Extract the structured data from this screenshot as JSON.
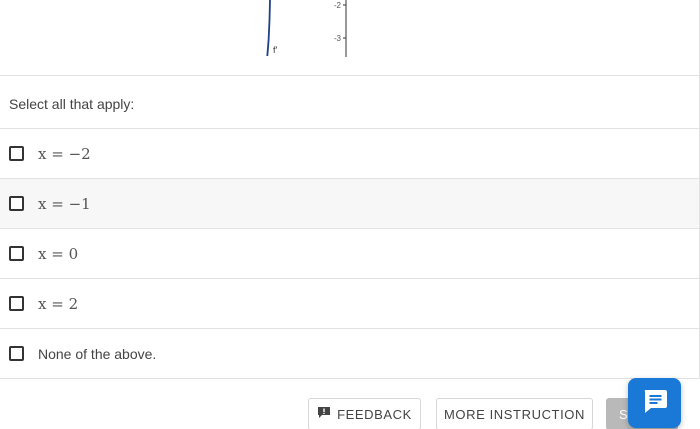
{
  "graph": {
    "tick_labels": [
      "-2",
      "-3"
    ],
    "function_label": "f'"
  },
  "prompt": "Select all that apply:",
  "options": [
    {
      "label": "x = −2",
      "checked": false
    },
    {
      "label": "x = −1",
      "checked": false
    },
    {
      "label": "x = 0",
      "checked": false
    },
    {
      "label": "x = 2",
      "checked": false
    },
    {
      "label": "None of the above.",
      "checked": false
    }
  ],
  "footer": {
    "feedback_label": "FEEDBACK",
    "instruction_label": "MORE INSTRUCTION",
    "submit_label": "S"
  },
  "icons": {
    "feedback": "feedback-icon",
    "chat": "chat-icon"
  },
  "colors": {
    "curve": "#1f3f8a",
    "chat_button": "#1a78d6",
    "submit_disabled": "#b9b9b9"
  }
}
